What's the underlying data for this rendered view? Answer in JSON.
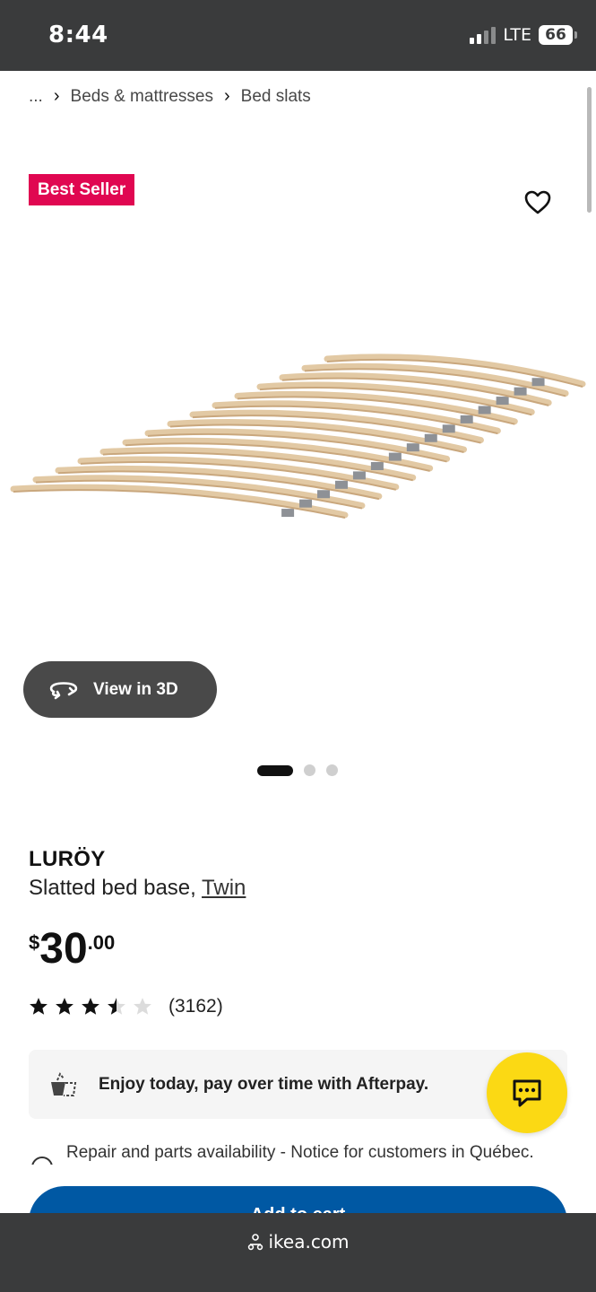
{
  "status_bar": {
    "time": "8:44",
    "network": "LTE",
    "battery": "66"
  },
  "breadcrumb": {
    "ellipsis": "...",
    "items": [
      "Beds & mattresses",
      "Bed slats"
    ]
  },
  "badge": "Best Seller",
  "view_3d_label": "View in 3D",
  "carousel": {
    "total": 3,
    "active": 1
  },
  "product": {
    "name": "LURÖY",
    "description": "Slatted bed base,",
    "size": "Twin",
    "price": {
      "currency": "$",
      "integer": "30",
      "decimal": ".00"
    },
    "rating": {
      "value": 3.5,
      "max": 5,
      "count": "(3162)"
    }
  },
  "afterpay": {
    "text": "Enjoy today, pay over time with Afterpay."
  },
  "notice": "Repair and parts availability - Notice for customers in Québec.",
  "add_to_cart": "Add to cart",
  "url_bar": {
    "domain": "ikea.com"
  },
  "colors": {
    "badge": "#e00751",
    "cta": "#0058a3",
    "chat": "#fbd914",
    "chrome": "#3a3b3c"
  }
}
